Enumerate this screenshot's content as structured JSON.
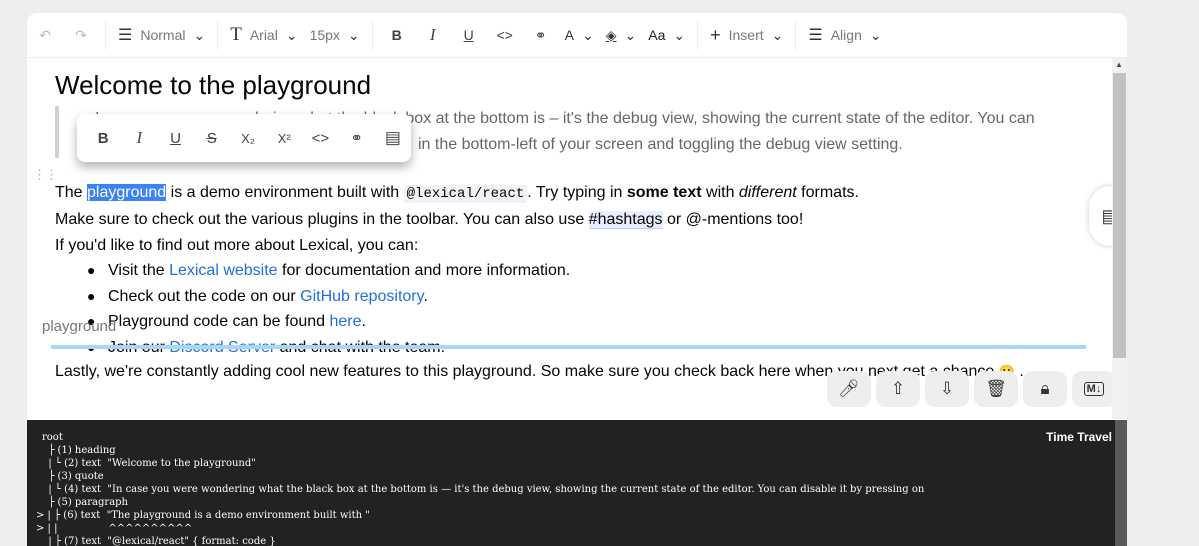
{
  "toolbar": {
    "block_type": "Normal",
    "font_family": "Arial",
    "font_size": "15px",
    "font_color_label": "A",
    "case_label": "Aa",
    "insert_label": "Insert",
    "align_label": "Align"
  },
  "editor": {
    "heading": "Welcome to the playground",
    "quote_line1": "In case you were wondering what the black box at the bottom is – it's the debug view, showing the current state of the editor. You can",
    "quote_line2": "in the bottom-left of your screen and toggling the debug view setting.",
    "p1": {
      "t1": "The ",
      "selected": "playground",
      "t2": " is a demo environment built with ",
      "code": "@lexical/react",
      "t3": ". Try typing in ",
      "bold": "some text",
      "t4": " with ",
      "italic": "different",
      "t5": " formats."
    },
    "p2": {
      "t1": "Make sure to check out the various plugins in the toolbar. You can also use ",
      "hashtag": "#hashtags",
      "t2": " or @-mentions too!"
    },
    "p3": "If you'd like to find out more about Lexical, you can:",
    "list": [
      {
        "before": "Visit the ",
        "link": "Lexical website",
        "after": " for documentation and more information."
      },
      {
        "before": "Check out the code on our ",
        "link": "GitHub repository",
        "after": "."
      },
      {
        "before": "Playground code can be found ",
        "link": "here",
        "after": "."
      },
      {
        "before": "Join our ",
        "link": "Discord Server",
        "after": " and chat with the team."
      }
    ],
    "ghost_label": "playground",
    "p4": "Lastly, we're constantly adding cool new features to this playground. So make sure you check back here when you next get a chance",
    "p4_end": " .",
    "emoji": "🙂"
  },
  "floating_toolbar": {
    "bold": "B",
    "italic": "I",
    "underline": "U",
    "strike": "S",
    "subscript": "X₂",
    "superscript": "X²"
  },
  "actions": {
    "markdown_label": "M↓"
  },
  "debug": {
    "time_travel": "Time Travel",
    "lines": [
      "root",
      "  ├ (1) heading",
      "  | └ (2) text  \"Welcome to the playground\"",
      "  ├ (3) quote",
      "  | └ (4) text  \"In case you were wondering what the black box at the bottom is — it's the debug view, showing the current state of the editor. You can disable it by pressing on",
      "  ├ (5) paragraph",
      "> | ├ (6) text  \"The playground is a demo environment built with \"",
      "> | |                ^^^^^^^^^^",
      "  | ├ (7) text  \"@lexical/react\" { format: code }"
    ]
  },
  "colors": {
    "selection": "#3b82f6",
    "link": "#216fdb",
    "drop_line": "#a6d8f3",
    "debug_bg": "#222222"
  }
}
